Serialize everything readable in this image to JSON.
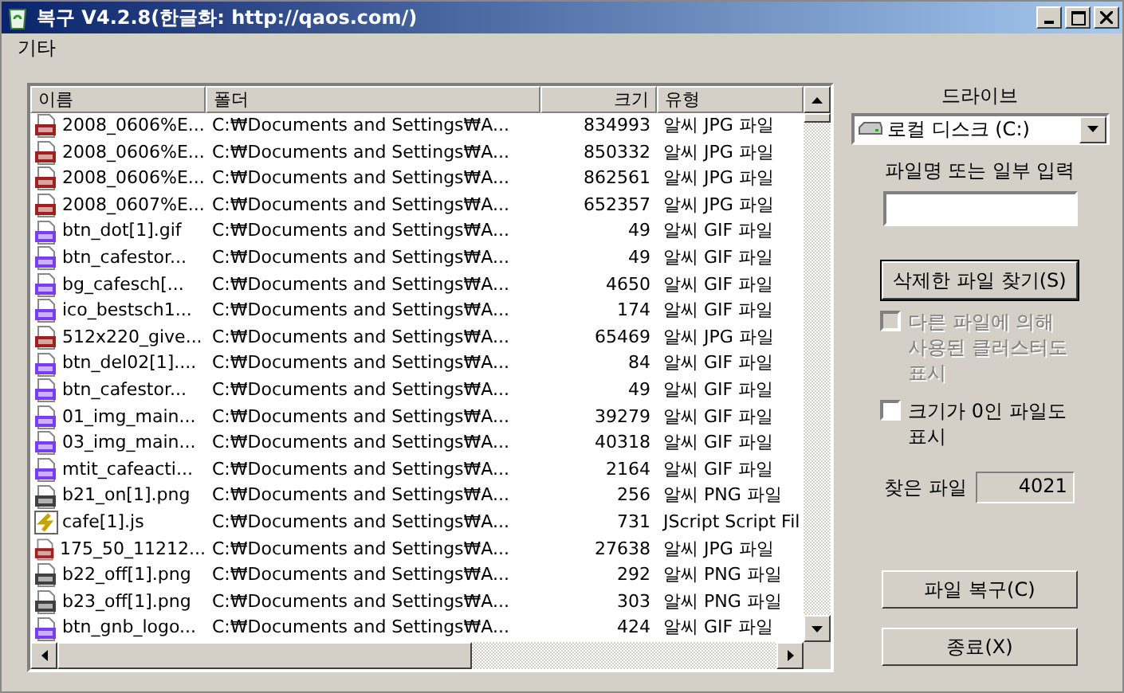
{
  "window": {
    "title": "복구 V4.2.8(한글화: http://qaos.com/)"
  },
  "menu": [
    "기타"
  ],
  "table": {
    "columns": [
      "이름",
      "폴더",
      "크기",
      "유형"
    ],
    "rows": [
      {
        "kind": "jpg",
        "name": "2008_0606%E...",
        "folder": "C:₩Documents and Settings₩A...",
        "size": "834993",
        "type": "알씨 JPG 파일"
      },
      {
        "kind": "jpg",
        "name": "2008_0606%E...",
        "folder": "C:₩Documents and Settings₩A...",
        "size": "850332",
        "type": "알씨 JPG 파일"
      },
      {
        "kind": "jpg",
        "name": "2008_0606%E...",
        "folder": "C:₩Documents and Settings₩A...",
        "size": "862561",
        "type": "알씨 JPG 파일"
      },
      {
        "kind": "jpg",
        "name": "2008_0607%E...",
        "folder": "C:₩Documents and Settings₩A...",
        "size": "652357",
        "type": "알씨 JPG 파일"
      },
      {
        "kind": "gif",
        "name": "btn_dot[1].gif",
        "folder": "C:₩Documents and Settings₩A...",
        "size": "49",
        "type": "알씨 GIF 파일"
      },
      {
        "kind": "gif",
        "name": "btn_cafestor...",
        "folder": "C:₩Documents and Settings₩A...",
        "size": "49",
        "type": "알씨 GIF 파일"
      },
      {
        "kind": "gif",
        "name": "bg_cafesch[...",
        "folder": "C:₩Documents and Settings₩A...",
        "size": "4650",
        "type": "알씨 GIF 파일"
      },
      {
        "kind": "gif",
        "name": "ico_bestsch1...",
        "folder": "C:₩Documents and Settings₩A...",
        "size": "174",
        "type": "알씨 GIF 파일"
      },
      {
        "kind": "jpg",
        "name": "512x220_give...",
        "folder": "C:₩Documents and Settings₩A...",
        "size": "65469",
        "type": "알씨 JPG 파일"
      },
      {
        "kind": "gif",
        "name": "btn_del02[1]....",
        "folder": "C:₩Documents and Settings₩A...",
        "size": "84",
        "type": "알씨 GIF 파일"
      },
      {
        "kind": "gif",
        "name": "btn_cafestor...",
        "folder": "C:₩Documents and Settings₩A...",
        "size": "49",
        "type": "알씨 GIF 파일"
      },
      {
        "kind": "gif",
        "name": "01_img_main...",
        "folder": "C:₩Documents and Settings₩A...",
        "size": "39279",
        "type": "알씨 GIF 파일"
      },
      {
        "kind": "gif",
        "name": "03_img_main...",
        "folder": "C:₩Documents and Settings₩A...",
        "size": "40318",
        "type": "알씨 GIF 파일"
      },
      {
        "kind": "gif",
        "name": "mtit_cafeacti...",
        "folder": "C:₩Documents and Settings₩A...",
        "size": "2164",
        "type": "알씨 GIF 파일"
      },
      {
        "kind": "png",
        "name": "b21_on[1].png",
        "folder": "C:₩Documents and Settings₩A...",
        "size": "256",
        "type": "알씨 PNG 파일"
      },
      {
        "kind": "js",
        "name": "cafe[1].js",
        "folder": "C:₩Documents and Settings₩A...",
        "size": "731",
        "type": "JScript Script Fil"
      },
      {
        "kind": "jpg",
        "name": "175_50_11212...",
        "folder": "C:₩Documents and Settings₩A...",
        "size": "27638",
        "type": "알씨 JPG 파일"
      },
      {
        "kind": "png",
        "name": "b22_off[1].png",
        "folder": "C:₩Documents and Settings₩A...",
        "size": "292",
        "type": "알씨 PNG 파일"
      },
      {
        "kind": "png",
        "name": "b23_off[1].png",
        "folder": "C:₩Documents and Settings₩A...",
        "size": "303",
        "type": "알씨 PNG 파일"
      },
      {
        "kind": "gif",
        "name": "btn_gnb_logo...",
        "folder": "C:₩Documents and Settings₩A...",
        "size": "424",
        "type": "알씨 GIF 파일"
      }
    ]
  },
  "drive": {
    "label": "드라이브",
    "value": "로컬 디스크 (C:)"
  },
  "filename": {
    "label": "파일명 또는 일부 입력"
  },
  "search_button": "삭제한 파일 찾기(S)",
  "options": [
    {
      "label": "다른 파일에 의해 사용된 클러스터도 표시",
      "checked": false,
      "disabled": true
    },
    {
      "label": "크기가 0인 파일도 표시",
      "checked": false,
      "disabled": false
    }
  ],
  "found": {
    "label": "찾은 파일",
    "value": "4021"
  },
  "buttons": [
    "파일 복구(C)",
    "종료(X)"
  ]
}
